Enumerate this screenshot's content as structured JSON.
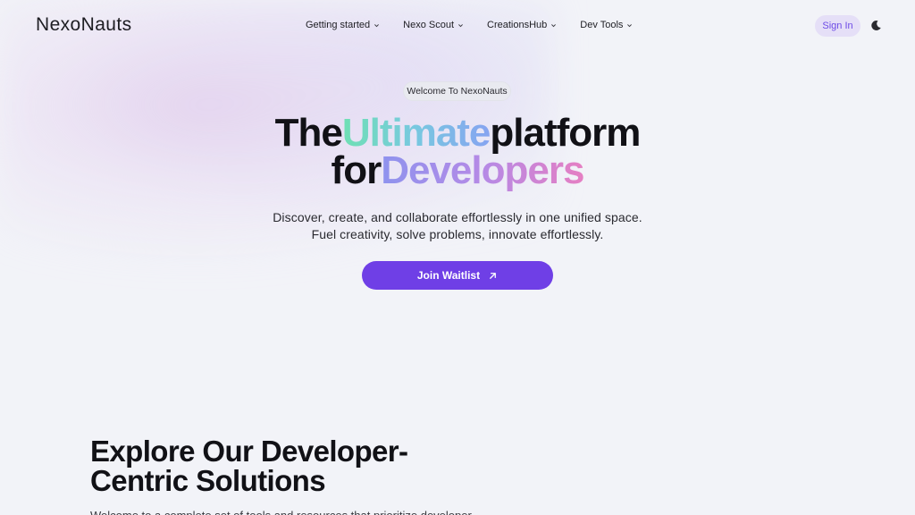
{
  "brand": {
    "name": "NexoNauts"
  },
  "nav": {
    "items": [
      {
        "label": "Getting started",
        "icon": "chevron-down-icon"
      },
      {
        "label": "Nexo Scout",
        "icon": "chevron-down-icon"
      },
      {
        "label": "CreationsHub",
        "icon": "chevron-down-icon"
      },
      {
        "label": "Dev Tools",
        "icon": "chevron-down-icon"
      }
    ],
    "sign_in_label": "Sign In",
    "theme_toggle_icon": "moon-icon"
  },
  "hero": {
    "badge": "Welcome To NexoNauts",
    "line1_before": "The",
    "line1_highlight": "Ultimate",
    "line1_after": "platform",
    "line2_before": "for",
    "line2_highlight": "Developers",
    "subtitle_line1": "Discover, create, and collaborate effortlessly in one unified space.",
    "subtitle_line2": "Fuel creativity, solve problems, innovate effortlessly.",
    "cta_label": "Join Waitlist",
    "cta_icon": "arrow-up-right-icon"
  },
  "solutions": {
    "title": "Explore Our Developer-Centric Solutions",
    "intro": "Welcome to  a complete set of tools and resources that prioritize developer"
  },
  "colors": {
    "accent": "#6f3fe6",
    "sign_in_bg": "#e5dff7",
    "sign_in_text": "#6d4be6",
    "background": "#f2f3f8"
  }
}
